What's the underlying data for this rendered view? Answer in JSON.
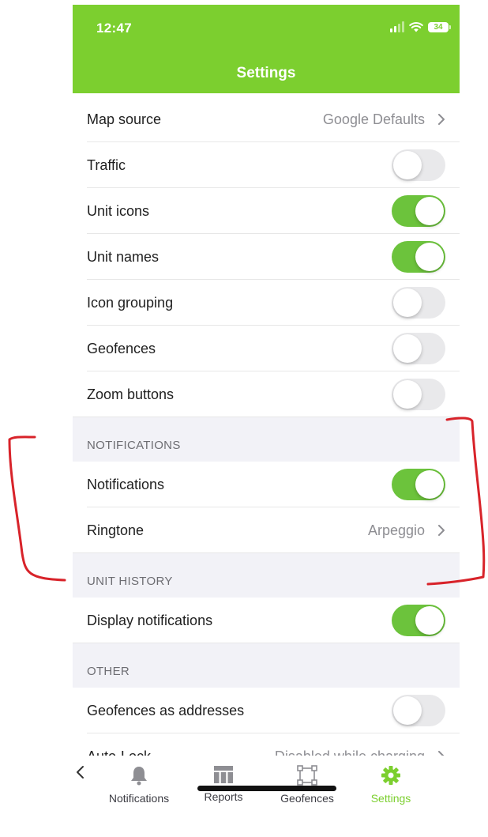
{
  "status_bar": {
    "time": "12:47",
    "battery": "34"
  },
  "header": {
    "title": "Settings"
  },
  "rows_map": [
    {
      "label": "Map source",
      "value": "Google Defaults",
      "type": "link"
    },
    {
      "label": "Traffic",
      "type": "toggle",
      "on": false
    },
    {
      "label": "Unit icons",
      "type": "toggle",
      "on": true
    },
    {
      "label": "Unit names",
      "type": "toggle",
      "on": true
    },
    {
      "label": "Icon grouping",
      "type": "toggle",
      "on": false
    },
    {
      "label": "Geofences",
      "type": "toggle",
      "on": false
    },
    {
      "label": "Zoom buttons",
      "type": "toggle",
      "on": false
    }
  ],
  "section_notifications": {
    "header": "NOTIFICATIONS",
    "rows": [
      {
        "label": "Notifications",
        "type": "toggle",
        "on": true
      },
      {
        "label": "Ringtone",
        "value": "Arpeggio",
        "type": "link"
      }
    ]
  },
  "section_unit_history": {
    "header": "UNIT HISTORY",
    "rows": [
      {
        "label": "Display notifications",
        "type": "toggle",
        "on": true
      }
    ]
  },
  "section_other": {
    "header": "OTHER",
    "rows": [
      {
        "label": "Geofences as addresses",
        "type": "toggle",
        "on": false
      },
      {
        "label": "Auto-Lock",
        "value": "Disabled while charging",
        "type": "link"
      }
    ]
  },
  "tabbar": {
    "tabs": [
      {
        "label": "Notifications",
        "icon": "bell-icon",
        "active": false
      },
      {
        "label": "Reports",
        "icon": "table-icon",
        "active": false
      },
      {
        "label": "Geofences",
        "icon": "geofence-icon",
        "active": false
      },
      {
        "label": "Settings",
        "icon": "gear-icon",
        "active": true
      }
    ]
  },
  "colors": {
    "accent": "#7ccf2f",
    "toggle_on": "#6cc33c",
    "toggle_off": "#e9e9eb",
    "annotation": "#d8232a"
  }
}
